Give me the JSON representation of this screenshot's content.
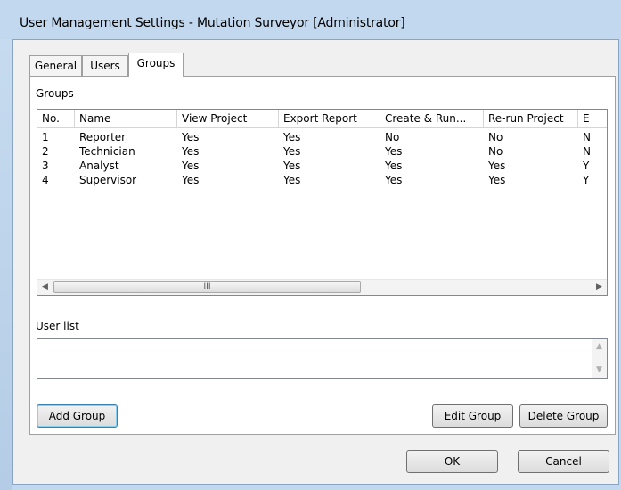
{
  "window": {
    "title": "User Management Settings - Mutation Surveyor [Administrator]"
  },
  "tabs": [
    {
      "label": "General",
      "active": false
    },
    {
      "label": "Users",
      "active": false
    },
    {
      "label": "Groups",
      "active": true
    }
  ],
  "groups_panel": {
    "groups_label": "Groups",
    "columns": [
      "No.",
      "Name",
      "View Project",
      "Export Report",
      "Create & Run...",
      "Re-run Project",
      "E"
    ],
    "rows": [
      [
        "1",
        "Reporter",
        "Yes",
        "Yes",
        "No",
        "No",
        "N"
      ],
      [
        "2",
        "Technician",
        "Yes",
        "Yes",
        "Yes",
        "No",
        "N"
      ],
      [
        "3",
        "Analyst",
        "Yes",
        "Yes",
        "Yes",
        "Yes",
        "Y"
      ],
      [
        "4",
        "Supervisor",
        "Yes",
        "Yes",
        "Yes",
        "Yes",
        "Y"
      ]
    ],
    "scroll_left": "◀",
    "scroll_right": "▶",
    "scroll_thumb_grip": "III",
    "user_list_label": "User list",
    "user_list_scroll_up": "▲",
    "user_list_scroll_down": "▼",
    "add_group_label": "Add Group",
    "edit_group_label": "Edit Group",
    "delete_group_label": "Delete Group"
  },
  "dialog_buttons": {
    "ok_label": "OK",
    "cancel_label": "Cancel"
  },
  "colors": {
    "frame": "#c2d8ef",
    "client": "#f0f0f0",
    "default_button_border": "#3c7fb1"
  }
}
